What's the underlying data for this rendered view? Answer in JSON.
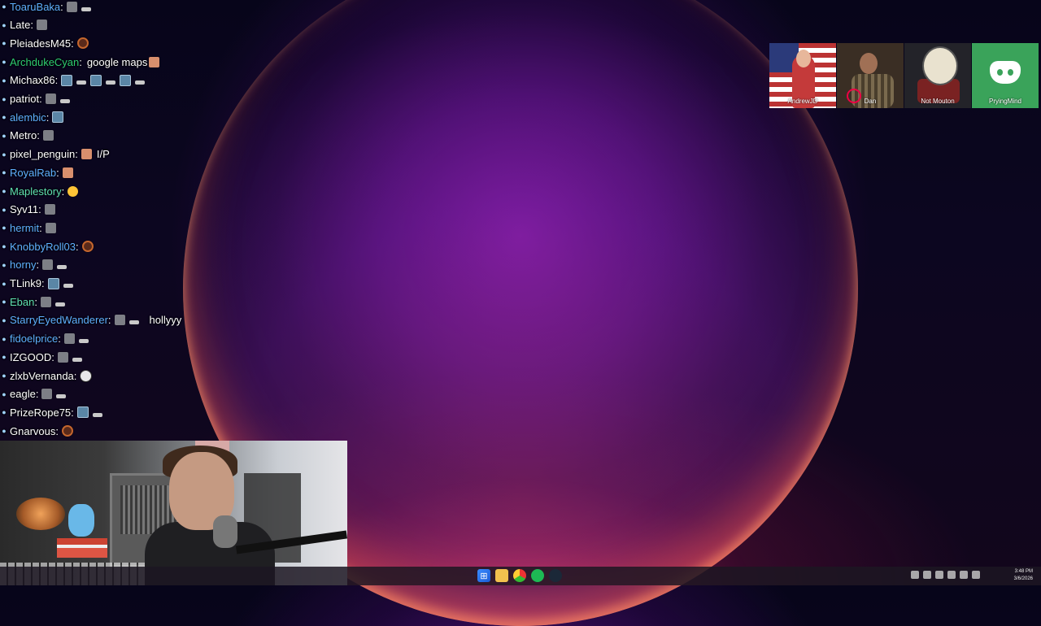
{
  "chat": {
    "messages": [
      {
        "user": "ToaruBaka",
        "color": "#5fb0ff",
        "text": "",
        "emotes": [
          "gray",
          "pointer"
        ]
      },
      {
        "user": "Late",
        "color": "#ffffff",
        "text": "",
        "emotes": [
          "gray"
        ]
      },
      {
        "user": "PleiadesM45",
        "color": "#ffffff",
        "text": "",
        "emotes": [
          "ball"
        ]
      },
      {
        "user": "ArchdukeCyan",
        "color": "#2ecc71",
        "text": "google maps",
        "emotes": [
          "face"
        ]
      },
      {
        "user": "Michax86",
        "color": "#ffffff",
        "text": "",
        "emotes": [
          "blue",
          "pointer",
          "blue",
          "pointer",
          "blue",
          "pointer"
        ]
      },
      {
        "user": "patriot",
        "color": "#ffffff",
        "text": "",
        "emotes": [
          "gray",
          "pointer"
        ]
      },
      {
        "user": "alembic",
        "color": "#5fb0ff",
        "text": "",
        "emotes": [
          "blue"
        ]
      },
      {
        "user": "Metro",
        "color": "#ffffff",
        "text": "",
        "emotes": [
          "gray"
        ]
      },
      {
        "user": "pixel_penguin",
        "color": "#ffffff",
        "text": "I/P",
        "emotes": [
          "face"
        ]
      },
      {
        "user": "RoyalRab",
        "color": "#5fb0ff",
        "text": "",
        "emotes": [
          "face"
        ]
      },
      {
        "user": "Maplestory",
        "color": "#5fe0b0",
        "text": "",
        "emotes": [
          "yellow"
        ]
      },
      {
        "user": "Syv11",
        "color": "#ffffff",
        "text": "",
        "emotes": [
          "gray"
        ]
      },
      {
        "user": "hermit",
        "color": "#5fb0ff",
        "text": "",
        "emotes": [
          "gray"
        ]
      },
      {
        "user": "KnobbyRoll03",
        "color": "#5fb0ff",
        "text": "",
        "emotes": [
          "ball"
        ]
      },
      {
        "user": "horny",
        "color": "#5fb0ff",
        "text": "",
        "emotes": [
          "gray",
          "pointer"
        ]
      },
      {
        "user": "TLink9",
        "color": "#ffffff",
        "text": "",
        "emotes": [
          "blue",
          "pointer"
        ]
      },
      {
        "user": "Eban",
        "color": "#5fe0b0",
        "text": "",
        "emotes": [
          "gray",
          "pointer"
        ]
      },
      {
        "user": "StarryEyedWanderer",
        "color": "#5fb0ff",
        "text": "hollyyy",
        "emotes": [
          "gray",
          "pointer"
        ]
      },
      {
        "user": "fidoelprice",
        "color": "#5fb0ff",
        "text": "",
        "emotes": [
          "gray",
          "pointer"
        ]
      },
      {
        "user": "IZGOOD",
        "color": "#ffffff",
        "text": "",
        "emotes": [
          "gray",
          "pointer"
        ]
      },
      {
        "user": "zlxbVernanda",
        "color": "#ffffff",
        "text": "",
        "emotes": [
          "smug"
        ]
      },
      {
        "user": "eagle",
        "color": "#ffffff",
        "text": "",
        "emotes": [
          "gray",
          "pointer"
        ]
      },
      {
        "user": "PrizeRope75",
        "color": "#ffffff",
        "text": "",
        "emotes": [
          "blue",
          "pointer"
        ]
      },
      {
        "user": "Gnarvous",
        "color": "#ffffff",
        "text": "",
        "emotes": [
          "ball"
        ]
      }
    ]
  },
  "voice": {
    "participants": [
      {
        "name": "AndrewJD",
        "icon": "avatar"
      },
      {
        "name": "Dan",
        "icon": "avatar"
      },
      {
        "name": "Not Mouton",
        "icon": "avatar"
      },
      {
        "name": "PryingMind",
        "icon": "discord-icon"
      }
    ]
  },
  "taskbar": {
    "apps": [
      "start-icon",
      "file-explorer-icon",
      "chrome-icon",
      "spotify-icon",
      "steam-icon"
    ],
    "time": "3:48 PM",
    "date": "3/6/2026"
  },
  "colors": {
    "accent": "#9b1fc4",
    "orb_rim": "#ff5a4a",
    "taskbar": "#1c1622"
  }
}
